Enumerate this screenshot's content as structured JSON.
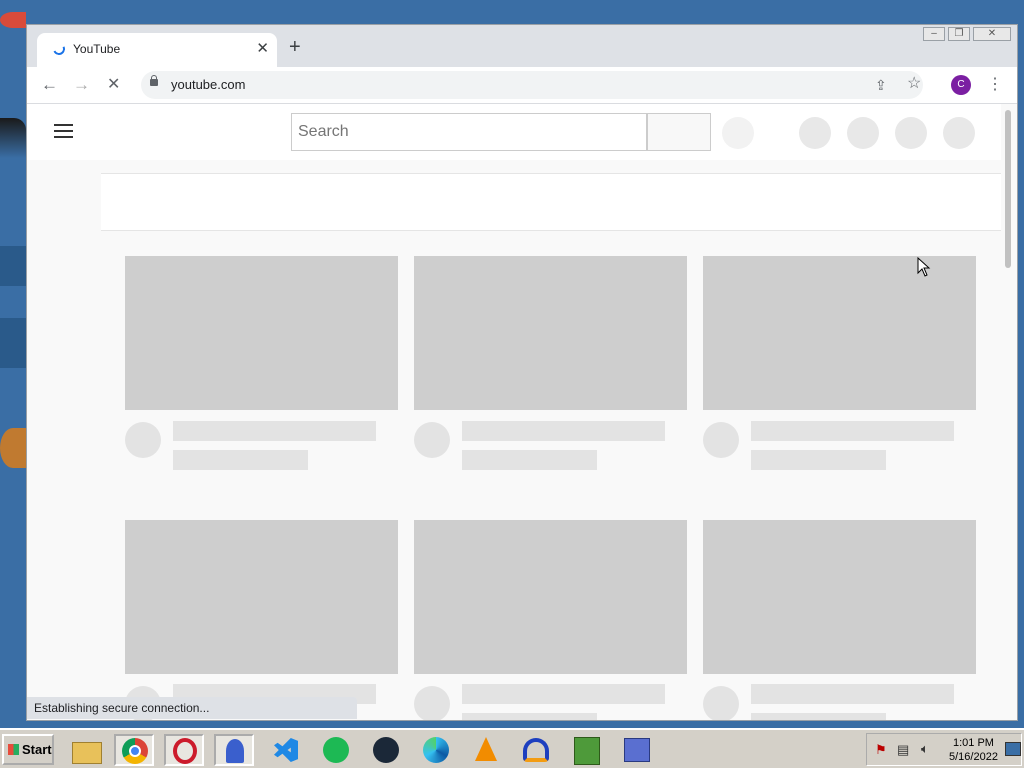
{
  "browser": {
    "tab_title": "YouTube",
    "new_tab_icon": "plus-icon",
    "url": "youtube.com",
    "profile_initial": "C",
    "profile_color": "#7b1fa2",
    "window_controls": [
      "minimize",
      "restore",
      "close"
    ]
  },
  "youtube": {
    "search_placeholder": "Search",
    "skeleton_rows": 2,
    "skeleton_columns": 3
  },
  "status_bar": {
    "text": "Establishing secure connection..."
  },
  "taskbar": {
    "start_label": "Start",
    "apps": [
      "file-explorer",
      "chrome",
      "opera",
      "unknown-app",
      "vscode",
      "spotify",
      "steam",
      "edge",
      "vlc",
      "audacity",
      "notepad-chart",
      "network-tool"
    ],
    "clock_time": "1:01 PM",
    "clock_date": "5/16/2022"
  }
}
